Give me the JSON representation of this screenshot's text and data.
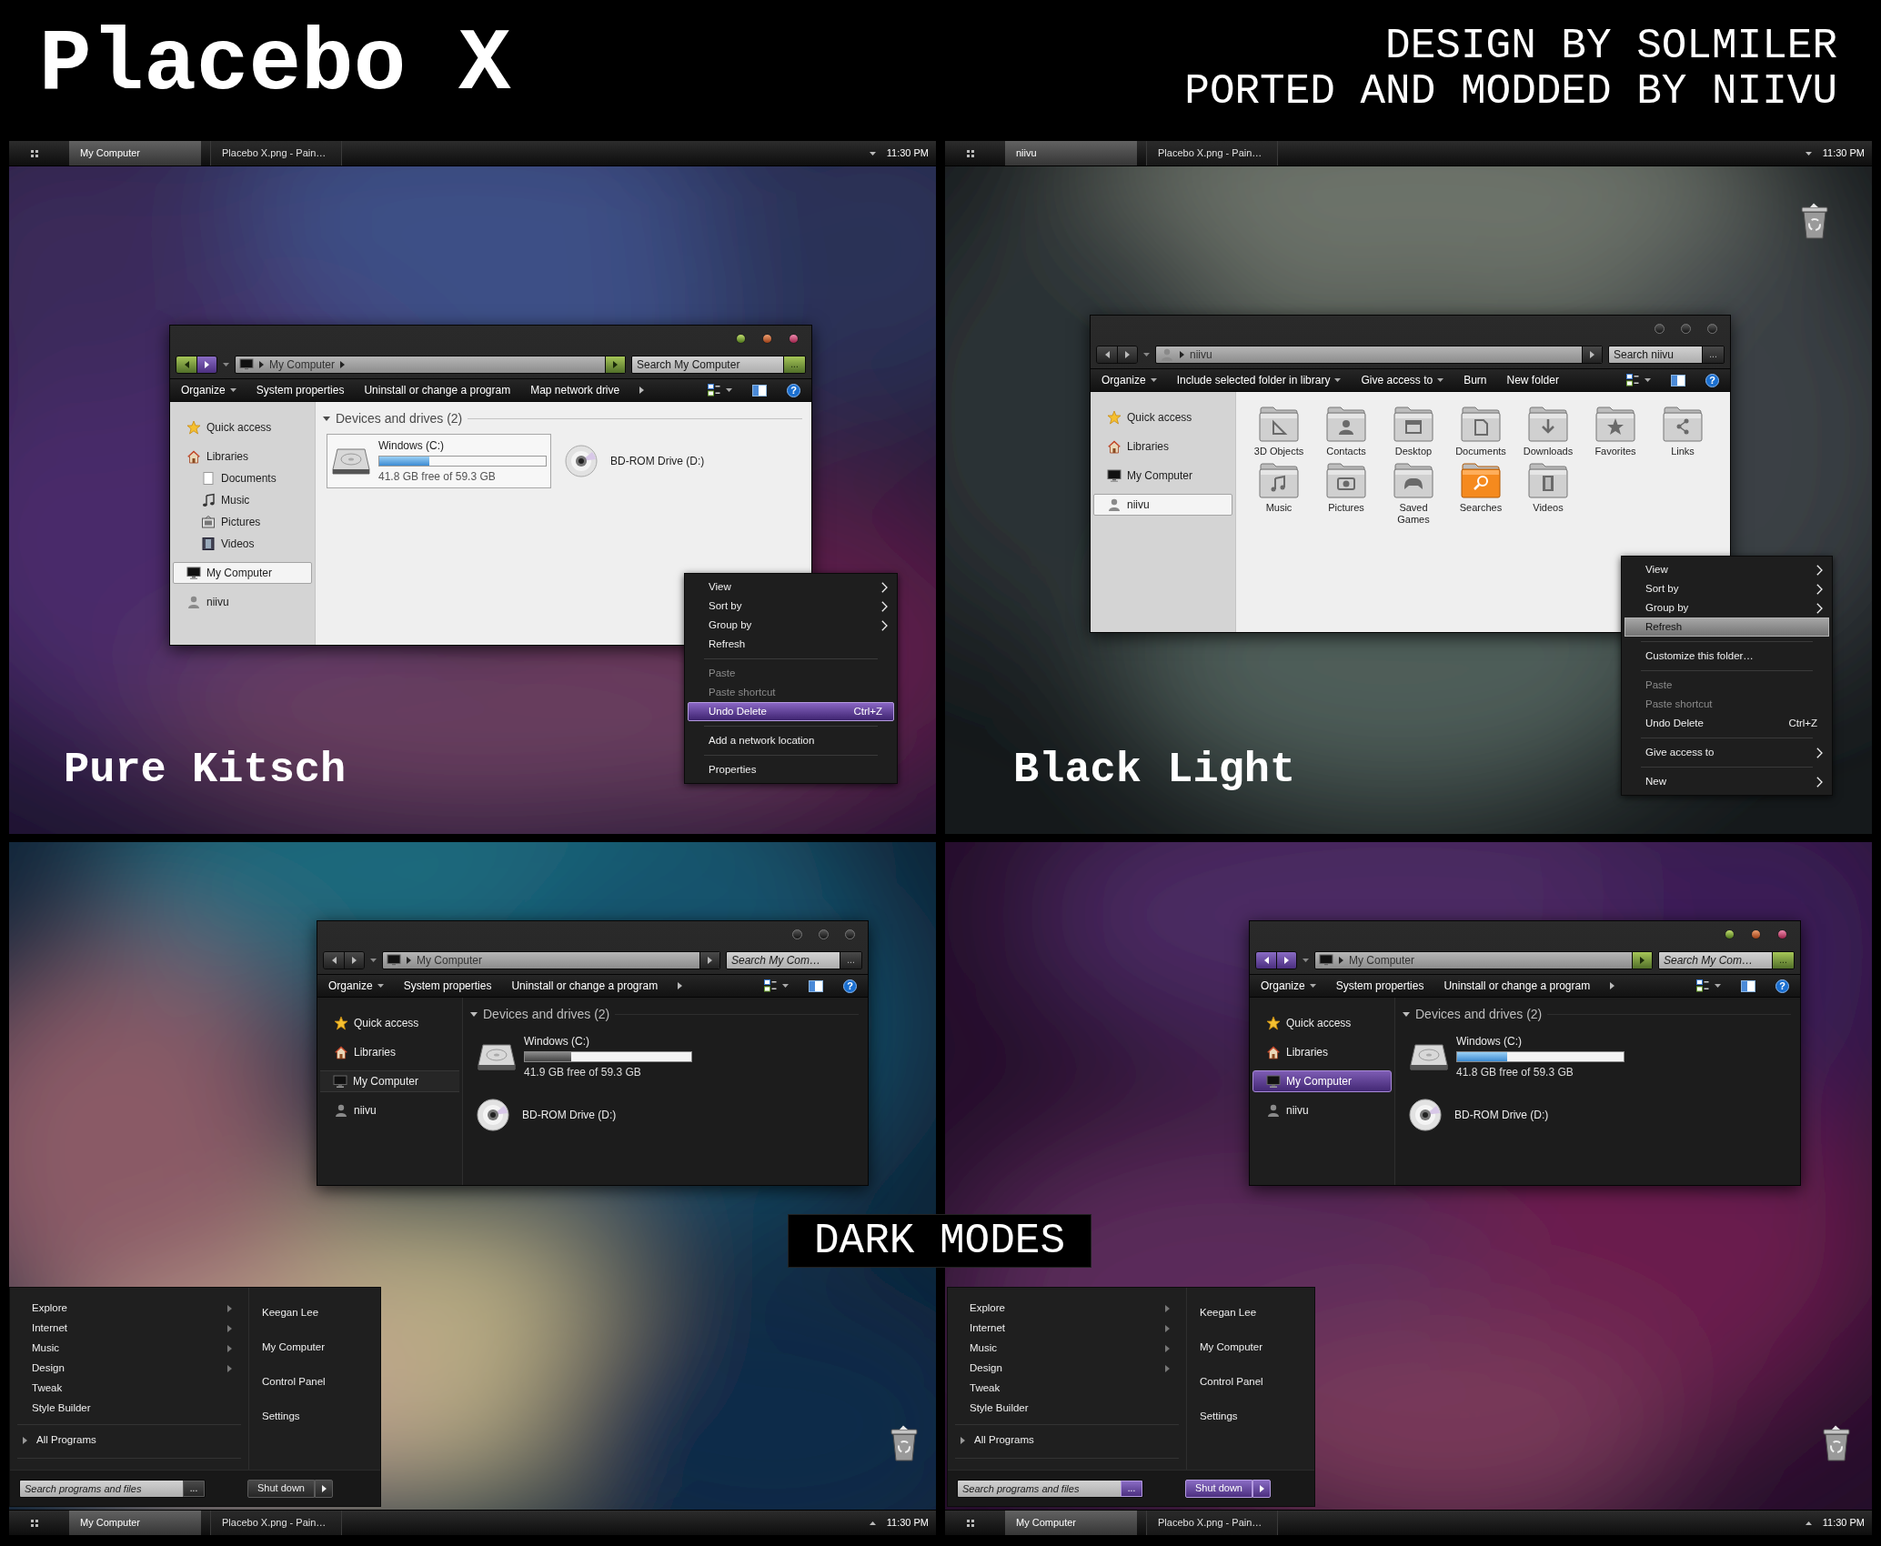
{
  "header": {
    "title": "Placebo X",
    "credits": [
      "DESIGN BY SOLMILER",
      "PORTED AND MODDED BY NIIVU"
    ]
  },
  "panels": [
    {
      "caption": "Pure Kitsch",
      "taskbar": {
        "buttons": [
          {
            "label": "My Computer",
            "selected": true
          },
          {
            "label": "Placebo X.png - Pain…",
            "selected": false
          }
        ],
        "clock": "11:30 PM"
      },
      "window": {
        "address": {
          "kind": "computer",
          "crumbs": [
            "My Computer"
          ],
          "trailing_arrow": true
        },
        "search": {
          "placeholder": "Search My Computer",
          "button": "..."
        },
        "toolbar": {
          "items": [
            {
              "label": "Organize",
              "dropdown": true
            },
            {
              "label": "System properties",
              "dropdown": false
            },
            {
              "label": "Uninstall or change a program",
              "dropdown": false
            },
            {
              "label": "Map network drive",
              "dropdown": false
            }
          ],
          "overflow": true,
          "help": "?"
        },
        "sidebar": [
          {
            "label": "Quick access",
            "kind": "star",
            "selected": false
          },
          {
            "label": "Libraries",
            "kind": "house",
            "selected": false,
            "children": [
              {
                "label": "Documents",
                "kind": "page",
                "selected": false
              },
              {
                "label": "Music",
                "kind": "note",
                "selected": false
              },
              {
                "label": "Pictures",
                "kind": "picture",
                "selected": false
              },
              {
                "label": "Videos",
                "kind": "film",
                "selected": false
              }
            ]
          },
          {
            "label": "My Computer",
            "kind": "monitor",
            "selected": true
          },
          {
            "label": "niivu",
            "kind": "person",
            "selected": false
          }
        ],
        "content": {
          "kind": "drives",
          "heading": "Devices and drives (2)",
          "drives": [
            {
              "kind": "hdd",
              "name": "Windows (C:)",
              "level": 0.3,
              "free": "41.8 GB free of 59.3 GB",
              "selected": true
            },
            {
              "kind": "optical",
              "name": "BD-ROM Drive (D:)",
              "selected": false
            }
          ]
        }
      },
      "context_menu": {
        "groups": [
          {
            "items": [
              {
                "label": "View",
                "submenu": true,
                "disabled": false,
                "selected": false
              },
              {
                "label": "Sort by",
                "submenu": true,
                "disabled": false,
                "selected": false
              },
              {
                "label": "Group by",
                "submenu": true,
                "disabled": false,
                "selected": false
              },
              {
                "label": "Refresh",
                "submenu": false,
                "disabled": false,
                "selected": false
              }
            ]
          },
          {
            "items": [
              {
                "label": "Paste",
                "submenu": false,
                "disabled": true,
                "selected": false
              },
              {
                "label": "Paste shortcut",
                "submenu": false,
                "disabled": true,
                "selected": false
              },
              {
                "label": "Undo Delete",
                "shortcut": "Ctrl+Z",
                "submenu": false,
                "disabled": false,
                "selected": true
              }
            ]
          },
          {
            "items": [
              {
                "label": "Add a network location",
                "submenu": false,
                "disabled": false,
                "selected": false
              }
            ]
          },
          {
            "items": [
              {
                "label": "Properties",
                "submenu": false,
                "disabled": false,
                "selected": false
              }
            ]
          }
        ]
      }
    },
    {
      "caption": "Black Light",
      "recycle_bin": true,
      "taskbar": {
        "buttons": [
          {
            "label": "niivu",
            "selected": true
          },
          {
            "label": "Placebo X.png - Pain…",
            "selected": false
          }
        ],
        "clock": "11:30 PM"
      },
      "window": {
        "address": {
          "kind": "person",
          "crumbs": [
            "niivu"
          ],
          "trailing_arrow": false
        },
        "search": {
          "placeholder": "Search niivu",
          "button": "..."
        },
        "toolbar": {
          "items": [
            {
              "label": "Organize",
              "dropdown": true
            },
            {
              "label": "Include selected folder in library",
              "dropdown": true
            },
            {
              "label": "Give access to",
              "dropdown": true
            },
            {
              "label": "Burn",
              "dropdown": false
            },
            {
              "label": "New folder",
              "dropdown": false
            }
          ],
          "overflow": false,
          "help": "?"
        },
        "sidebar": [
          {
            "label": "Quick access",
            "kind": "star",
            "selected": false
          },
          {
            "label": "Libraries",
            "kind": "house",
            "selected": false
          },
          {
            "label": "My Computer",
            "kind": "monitor",
            "selected": false
          },
          {
            "label": "niivu",
            "kind": "person",
            "selected": true
          }
        ],
        "content": {
          "kind": "folders",
          "folders": [
            {
              "name": "3D Objects",
              "kind": "ruler",
              "selected": false
            },
            {
              "name": "Contacts",
              "kind": "person",
              "selected": false
            },
            {
              "name": "Desktop",
              "kind": "window",
              "selected": false
            },
            {
              "name": "Documents",
              "kind": "page",
              "selected": false
            },
            {
              "name": "Downloads",
              "kind": "download",
              "selected": false
            },
            {
              "name": "Favorites",
              "kind": "star",
              "selected": false
            },
            {
              "name": "Links",
              "kind": "share",
              "selected": false
            },
            {
              "name": "Music",
              "kind": "note",
              "selected": false
            },
            {
              "name": "Pictures",
              "kind": "camera",
              "selected": false
            },
            {
              "name": "Saved Games",
              "kind": "gamepad",
              "selected": false
            },
            {
              "name": "Searches",
              "kind": "search",
              "selected": true
            },
            {
              "name": "Videos",
              "kind": "film",
              "selected": false
            }
          ]
        }
      },
      "context_menu": {
        "groups": [
          {
            "items": [
              {
                "label": "View",
                "submenu": true,
                "disabled": false,
                "selected": false
              },
              {
                "label": "Sort by",
                "submenu": true,
                "disabled": false,
                "selected": false
              },
              {
                "label": "Group by",
                "submenu": true,
                "disabled": false,
                "selected": false
              },
              {
                "label": "Refresh",
                "submenu": false,
                "disabled": false,
                "selected": true
              }
            ]
          },
          {
            "items": [
              {
                "label": "Customize this folder…",
                "submenu": false,
                "disabled": false,
                "selected": false
              }
            ]
          },
          {
            "items": [
              {
                "label": "Paste",
                "submenu": false,
                "disabled": true,
                "selected": false
              },
              {
                "label": "Paste shortcut",
                "submenu": false,
                "disabled": true,
                "selected": false
              },
              {
                "label": "Undo Delete",
                "shortcut": "Ctrl+Z",
                "submenu": false,
                "disabled": false,
                "selected": false
              }
            ]
          },
          {
            "items": [
              {
                "label": "Give access to",
                "submenu": true,
                "disabled": false,
                "selected": false
              }
            ]
          },
          {
            "items": [
              {
                "label": "New",
                "submenu": true,
                "disabled": false,
                "selected": false
              }
            ]
          }
        ]
      }
    },
    {
      "recycle_bin": true,
      "taskbar": {
        "buttons": [
          {
            "label": "My Computer",
            "selected": true
          },
          {
            "label": "Placebo X.png - Pain…",
            "selected": false
          }
        ],
        "clock": "11:30 PM"
      },
      "window": {
        "address": {
          "kind": "computer",
          "crumbs": [
            "My Computer"
          ],
          "trailing_arrow": false
        },
        "search": {
          "placeholder": "Search My Com…",
          "button": "..."
        },
        "toolbar": {
          "items": [
            {
              "label": "Organize",
              "dropdown": true
            },
            {
              "label": "System properties",
              "dropdown": false
            },
            {
              "label": "Uninstall or change a program",
              "dropdown": false
            }
          ],
          "overflow": true,
          "help": "?"
        },
        "sidebar": [
          {
            "label": "Quick access",
            "kind": "star",
            "selected": false
          },
          {
            "label": "Libraries",
            "kind": "house",
            "selected": false
          },
          {
            "label": "My Computer",
            "kind": "monitor",
            "selected": true
          },
          {
            "label": "niivu",
            "kind": "person",
            "selected": false
          }
        ],
        "content": {
          "kind": "drives",
          "heading": "Devices and drives (2)",
          "drives": [
            {
              "kind": "hdd",
              "name": "Windows (C:)",
              "level": 0.28,
              "free": "41.9 GB free of 59.3 GB",
              "selected": false
            },
            {
              "kind": "optical",
              "name": "BD-ROM Drive (D:)",
              "selected": false
            }
          ]
        }
      },
      "start_menu": {
        "programs": [
          {
            "label": "Explore",
            "submenu": true
          },
          {
            "label": "Internet",
            "submenu": true
          },
          {
            "label": "Music",
            "submenu": true
          },
          {
            "label": "Design",
            "submenu": true
          },
          {
            "label": "Tweak",
            "submenu": false
          },
          {
            "label": "Style Builder",
            "submenu": false
          }
        ],
        "all_programs": "All Programs",
        "links": [
          "Keegan Lee",
          "My Computer",
          "Control Panel",
          "Settings"
        ],
        "search_placeholder": "Search programs and files",
        "search_button": "...",
        "shutdown": "Shut down"
      }
    },
    {
      "recycle_bin": true,
      "taskbar": {
        "buttons": [
          {
            "label": "My Computer",
            "selected": true
          },
          {
            "label": "Placebo X.png - Pain…",
            "selected": false
          }
        ],
        "clock": "11:30 PM"
      },
      "window": {
        "address": {
          "kind": "computer",
          "crumbs": [
            "My Computer"
          ],
          "trailing_arrow": false
        },
        "search": {
          "placeholder": "Search My Com…",
          "button": "..."
        },
        "toolbar": {
          "items": [
            {
              "label": "Organize",
              "dropdown": true
            },
            {
              "label": "System properties",
              "dropdown": false
            },
            {
              "label": "Uninstall or change a program",
              "dropdown": false
            }
          ],
          "overflow": true,
          "help": "?"
        },
        "sidebar": [
          {
            "label": "Quick access",
            "kind": "star",
            "selected": false
          },
          {
            "label": "Libraries",
            "kind": "house",
            "selected": false
          },
          {
            "label": "My Computer",
            "kind": "monitor",
            "selected": true
          },
          {
            "label": "niivu",
            "kind": "person",
            "selected": false
          }
        ],
        "content": {
          "kind": "drives",
          "heading": "Devices and drives (2)",
          "drives": [
            {
              "kind": "hdd",
              "name": "Windows (C:)",
              "level": 0.3,
              "free": "41.8 GB free of 59.3 GB",
              "selected": false
            },
            {
              "kind": "optical",
              "name": "BD-ROM Drive (D:)",
              "selected": false
            }
          ]
        }
      },
      "start_menu": {
        "programs": [
          {
            "label": "Explore",
            "submenu": true
          },
          {
            "label": "Internet",
            "submenu": true
          },
          {
            "label": "Music",
            "submenu": true
          },
          {
            "label": "Design",
            "submenu": true
          },
          {
            "label": "Tweak",
            "submenu": false
          },
          {
            "label": "Style Builder",
            "submenu": false
          }
        ],
        "all_programs": "All Programs",
        "links": [
          "Keegan Lee",
          "My Computer",
          "Control Panel",
          "Settings"
        ],
        "search_placeholder": "Search programs and files",
        "search_button": "...",
        "shutdown": "Shut down"
      }
    }
  ],
  "banner": "DARK MODES"
}
